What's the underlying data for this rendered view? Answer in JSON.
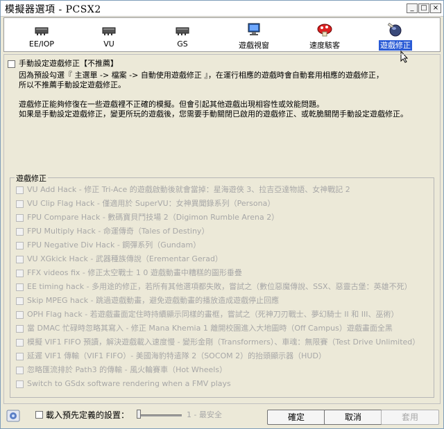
{
  "window": {
    "title": "模擬器選項 - PCSX2"
  },
  "toolbar": {
    "items": [
      {
        "label": "EE/IOP"
      },
      {
        "label": "VU"
      },
      {
        "label": "GS"
      },
      {
        "label": "遊戲視窗"
      },
      {
        "label": "速度駭客"
      },
      {
        "label": "遊戲修正"
      }
    ],
    "selected_index": 5
  },
  "manual": {
    "label": "手動設定遊戲修正【不推薦】",
    "desc_lines": [
      "因為預設勾選『 主選單 -> 檔案 -> 自動使用遊戲修正 』，在運行相應的遊戲時會自動套用相應的遊戲修正，",
      "所以不推薦手動設定遊戲修正。",
      "遊戲修正能夠修復在一些遊戲裡不正確的模擬。但會引起其他遊戲出現相容性或效能問題。",
      "如果是手動設定遊戲修正，變更所玩的遊戲後，您需要手動關閉已啟用的遊戲修正、或乾脆關閉手動設定遊戲修正。"
    ]
  },
  "group": {
    "title": "遊戲修正",
    "items": [
      "VU Add Hack - 修正 Tri-Ace 的遊戲啟動後就會當掉：星海遊俠 3、拉吉亞達物語、女神戰記 2",
      "VU Clip Flag Hack - 僅適用於 SuperVU：女神異聞錄系列（Persona）",
      "FPU Compare Hack - 數碼寶貝鬥技場 2（Digimon Rumble Arena 2）",
      "FPU Multiply Hack - 命運傳奇（Tales of Destiny）",
      "FPU Negative Div Hack - 鋼彈系列（Gundam）",
      "VU XGkick Hack - 武器種族傳說（Erementar Gerad）",
      "FFX videos fix - 修正太空戰士 1 0 遊戲動畫中糟糕的圖形垂疊",
      "EE timing hack - 多用途的修正，若所有其他選項都失敗，嘗試之（數位惡魔傳說、SSX、惡靈古堡：英雄不死）",
      "Skip MPEG hack - 跳過遊戲動畫，避免遊戲動畫的播放造成遊戲停止回應",
      "OPH Flag hack - 若遊戲畫面定住時持續顯示同樣的畫框，嘗試之（死神刀刃戰士、夢幻騎士 II 和 III、巫術）",
      "當 DMAC 忙碌時忽略其寫入 - 修正 Mana Khemia 1 離開校園進入大地圖時（Off Campus）遊戲畫面全黑",
      "模擬 VIF1 FIFO 預讀，解決遊戲載入速度慢 - 變形金剛（Transformers）、車魂：無限賽（Test Drive Unlimited）",
      "延遲 VIF1 傳輸（VIF1 FIFO）- 美國海豹特遣隊 2（SOCOM 2）的抬頭顯示器（HUD）",
      "忽略匯流排於 Path3 的傳輸 - 風火輪賽車（Hot Wheels）",
      "Switch to GSdx software rendering when a FMV plays"
    ]
  },
  "footer": {
    "preset_label": "載入預先定義的設置：",
    "slider_caption": "1 - 最安全",
    "slider_level": 1,
    "ok_label": "確定",
    "cancel_label": "取消",
    "apply_label": "套用"
  },
  "colors": {
    "selected": "#2a5bd6",
    "disabled_text": "#a7a7a7"
  }
}
